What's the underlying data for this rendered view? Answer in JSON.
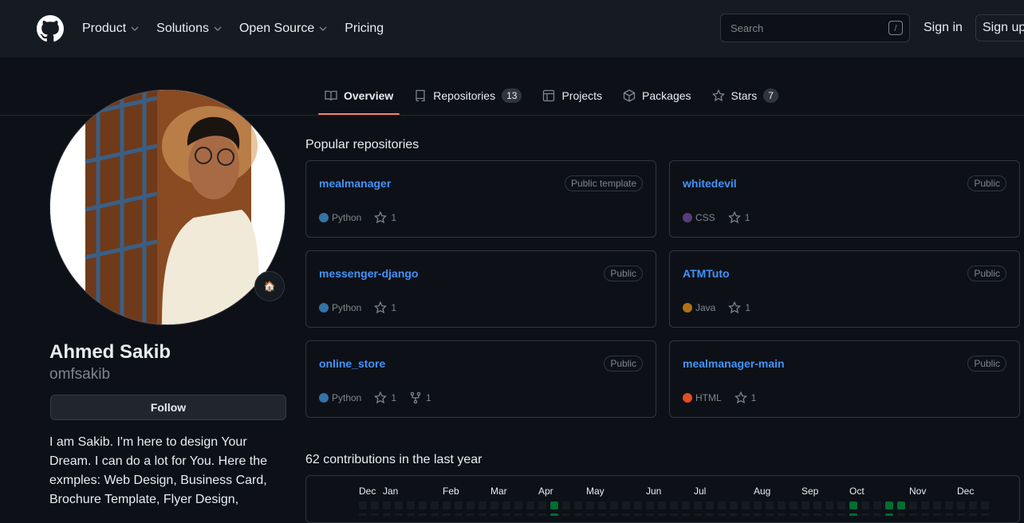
{
  "header": {
    "nav": [
      {
        "label": "Product",
        "has_dropdown": true
      },
      {
        "label": "Solutions",
        "has_dropdown": true
      },
      {
        "label": "Open Source",
        "has_dropdown": true
      },
      {
        "label": "Pricing",
        "has_dropdown": false
      }
    ],
    "search_placeholder": "Search",
    "search_shortcut": "/",
    "sign_in": "Sign in",
    "sign_up": "Sign up"
  },
  "tabs": [
    {
      "label": "Overview",
      "icon": "book-icon",
      "active": true
    },
    {
      "label": "Repositories",
      "icon": "repo-icon",
      "count": "13"
    },
    {
      "label": "Projects",
      "icon": "table-icon"
    },
    {
      "label": "Packages",
      "icon": "package-icon"
    },
    {
      "label": "Stars",
      "icon": "star-icon",
      "count": "7"
    }
  ],
  "profile": {
    "name": "Ahmed Sakib",
    "login": "omfsakib",
    "follow_label": "Follow",
    "status_emoji": "🏠",
    "bio_lines": [
      "I am Sakib. I'm here to design Your",
      "Dream. I can do a lot for You. Here the",
      "exmples: Web Design, Business Card,",
      "Brochure Template, Flyer Design,"
    ]
  },
  "popular": {
    "title": "Popular repositories",
    "repos": [
      {
        "name": "mealmanager",
        "visibility": "Public template",
        "language": "Python",
        "lang_color": "#3572A5",
        "stars": "1"
      },
      {
        "name": "whitedevil",
        "visibility": "Public",
        "language": "CSS",
        "lang_color": "#563d7c",
        "stars": "1"
      },
      {
        "name": "messenger-django",
        "visibility": "Public",
        "language": "Python",
        "lang_color": "#3572A5",
        "stars": "1"
      },
      {
        "name": "ATMTuto",
        "visibility": "Public",
        "language": "Java",
        "lang_color": "#b07219",
        "stars": "1"
      },
      {
        "name": "online_store",
        "visibility": "Public",
        "language": "Python",
        "lang_color": "#3572A5",
        "stars": "1",
        "forks": "1"
      },
      {
        "name": "mealmanager-main",
        "visibility": "Public",
        "language": "HTML",
        "lang_color": "#e34c26",
        "stars": "1"
      }
    ]
  },
  "contributions": {
    "title": "62 contributions in the last year",
    "months": [
      "Dec",
      "Jan",
      "Feb",
      "Mar",
      "Apr",
      "May",
      "Jun",
      "Jul",
      "Aug",
      "Sep",
      "Oct",
      "Nov",
      "Dec"
    ],
    "active_weeks_first_row": [
      16,
      41,
      44,
      45
    ],
    "active_weeks_second_row": [
      16,
      41,
      44
    ]
  },
  "colors": {
    "accent": "#f78166",
    "link": "#4493f8",
    "contrib_empty": "#161b22",
    "contrib_level": "#0e4429"
  }
}
